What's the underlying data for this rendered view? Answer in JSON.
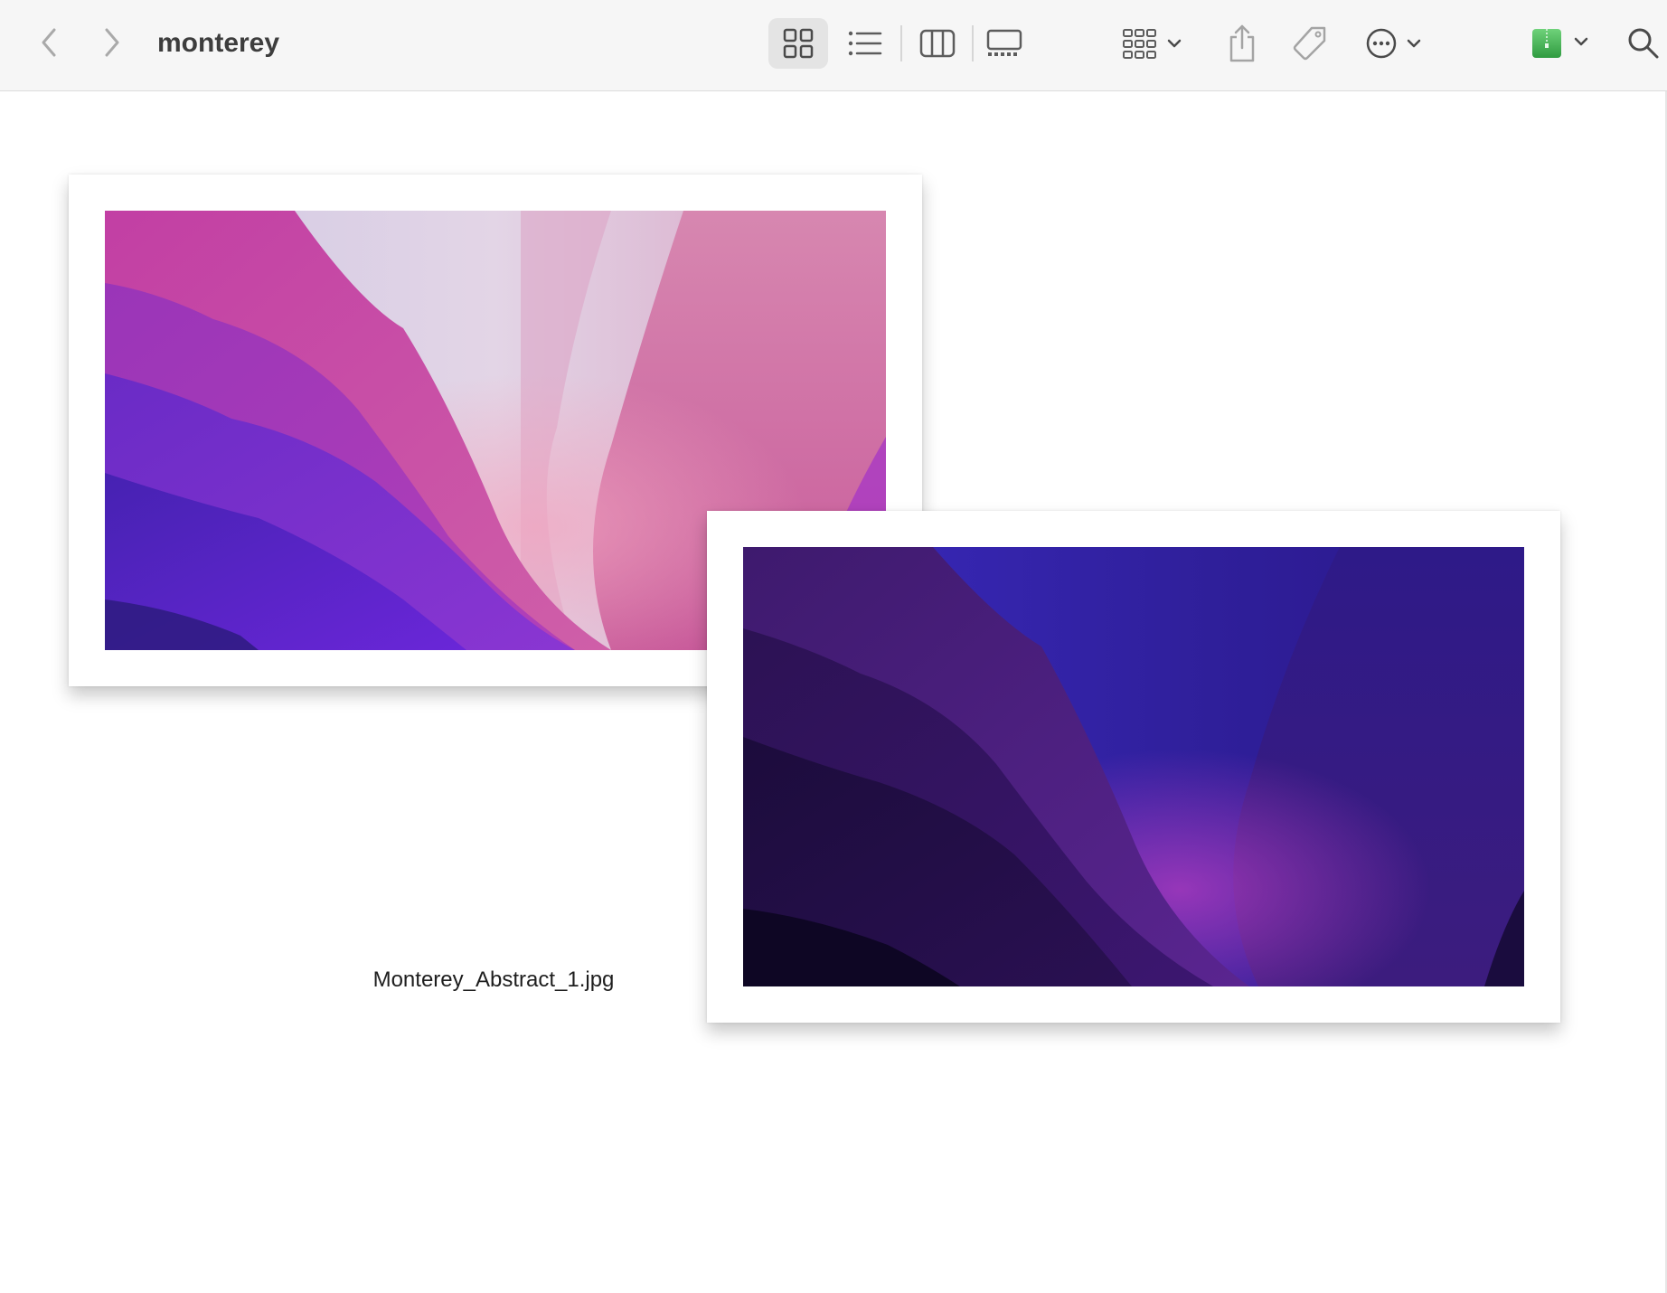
{
  "toolbar": {
    "folder_title": "monterey",
    "icons": {
      "back": "chevron-left-icon",
      "forward": "chevron-right-icon",
      "icon_view": "grid-view-icon",
      "list_view": "list-view-icon",
      "column_view": "column-view-icon",
      "gallery_view": "gallery-view-icon",
      "group": "group-by-icon",
      "share": "share-icon",
      "tag": "tag-icon",
      "action": "more-actions-icon",
      "archive": "archive-utility-icon",
      "search": "search-icon"
    },
    "active_view": "icon_view"
  },
  "files": [
    {
      "name": "Monterey_Abstract_1.jpg",
      "thumbnail": "monterey-light-wallpaper",
      "palette": [
        "#c23fa0",
        "#6a2bc8",
        "#d7a1c8",
        "#c96a9e"
      ]
    },
    {
      "thumbnail": "monterey-dark-wallpaper",
      "palette": [
        "#2a1160",
        "#3a1f9a",
        "#8a2fb0",
        "#120a2e"
      ]
    }
  ],
  "colors": {
    "toolbar_bg": "#f6f6f6",
    "selected_view_bg": "#e4e4e4",
    "icon_gray": "#5c5c5c",
    "archive_green": "#4cbb5a"
  }
}
